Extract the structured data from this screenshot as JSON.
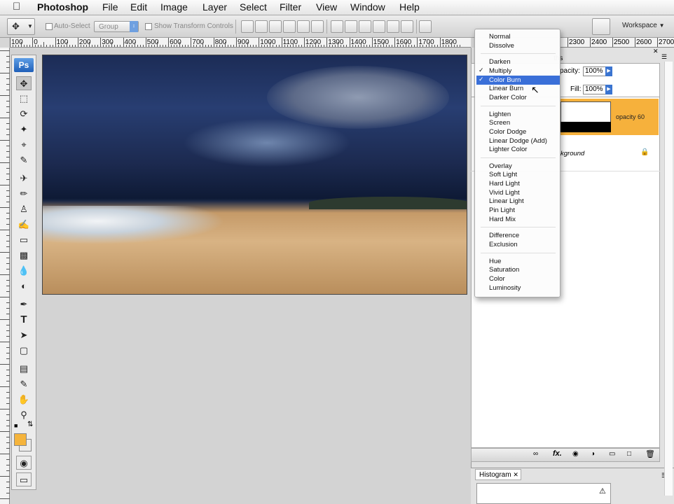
{
  "menubar": {
    "apple": "",
    "app_name": "Photoshop",
    "items": [
      "File",
      "Edit",
      "Image",
      "Layer",
      "Select",
      "Filter",
      "View",
      "Window",
      "Help"
    ]
  },
  "options_bar": {
    "auto_select_label": "Auto-Select",
    "auto_select_value": "Group",
    "show_transform_label": "Show Transform Controls",
    "workspace_label": "Workspace"
  },
  "ruler": {
    "labels": [
      "100",
      "0",
      "100",
      "200",
      "300",
      "400",
      "500",
      "600",
      "700",
      "800",
      "900",
      "1000",
      "1100",
      "1200",
      "1300",
      "1400",
      "1500",
      "1600",
      "1700",
      "1800"
    ],
    "right_labels": [
      "2300",
      "2400",
      "2500",
      "2600",
      "2700"
    ]
  },
  "toolbox": {
    "ps_logo": "Ps",
    "foreground_color": "#f5b43c",
    "background_color": "#ffffff"
  },
  "layers_panel": {
    "tab_partial": "ths",
    "opacity_label": "pacity:",
    "opacity_value": "100%",
    "fill_label": "Fill:",
    "fill_value": "100%",
    "layer_top_name": "opacity 60",
    "layer_bottom_name": "kground",
    "highlight_color": "#f6b13c"
  },
  "blend_menu": {
    "groups": [
      [
        "Normal",
        "Dissolve"
      ],
      [
        "Darken",
        "Multiply",
        "Color Burn",
        "Linear Burn",
        "Darker Color"
      ],
      [
        "Lighten",
        "Screen",
        "Color Dodge",
        "Linear Dodge (Add)",
        "Lighter Color"
      ],
      [
        "Overlay",
        "Soft Light",
        "Hard Light",
        "Vivid Light",
        "Linear Light",
        "Pin Light",
        "Hard Mix"
      ],
      [
        "Difference",
        "Exclusion"
      ],
      [
        "Hue",
        "Saturation",
        "Color",
        "Luminosity"
      ]
    ],
    "checked": "Multiply",
    "highlighted": "Color Burn"
  },
  "histogram_panel": {
    "tab_label": "Histogram"
  }
}
